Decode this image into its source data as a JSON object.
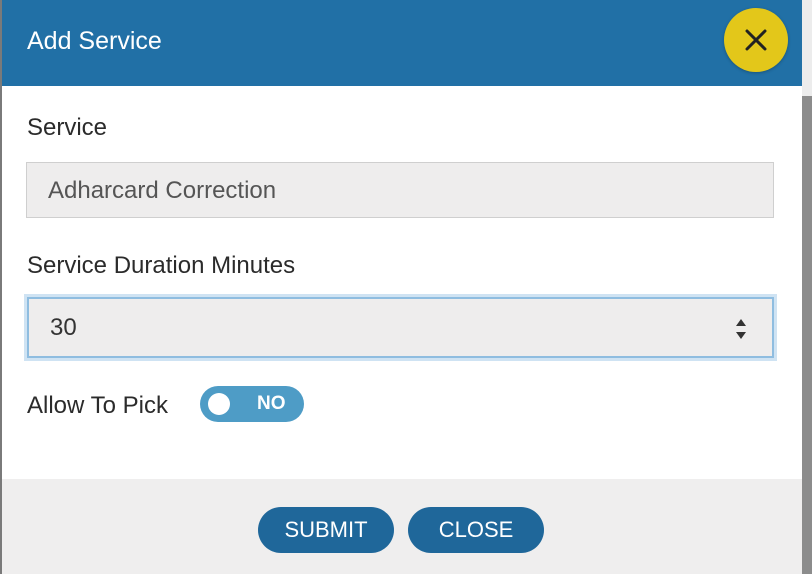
{
  "modal": {
    "title": "Add Service"
  },
  "form": {
    "service_label": "Service",
    "service_value": "Adharcard Correction",
    "duration_label": "Service Duration Minutes",
    "duration_value": "30",
    "allow_pick_label": "Allow To Pick",
    "allow_pick_toggle_text": "NO"
  },
  "footer": {
    "submit_label": "SUBMIT",
    "close_label": "CLOSE"
  },
  "icons": {
    "close": "close-icon",
    "spinner": "number-spinner-icon"
  },
  "colors": {
    "header": "#2170a6",
    "close_button": "#e3c71a",
    "toggle": "#4e9cc6",
    "primary_button": "#1f679a"
  }
}
